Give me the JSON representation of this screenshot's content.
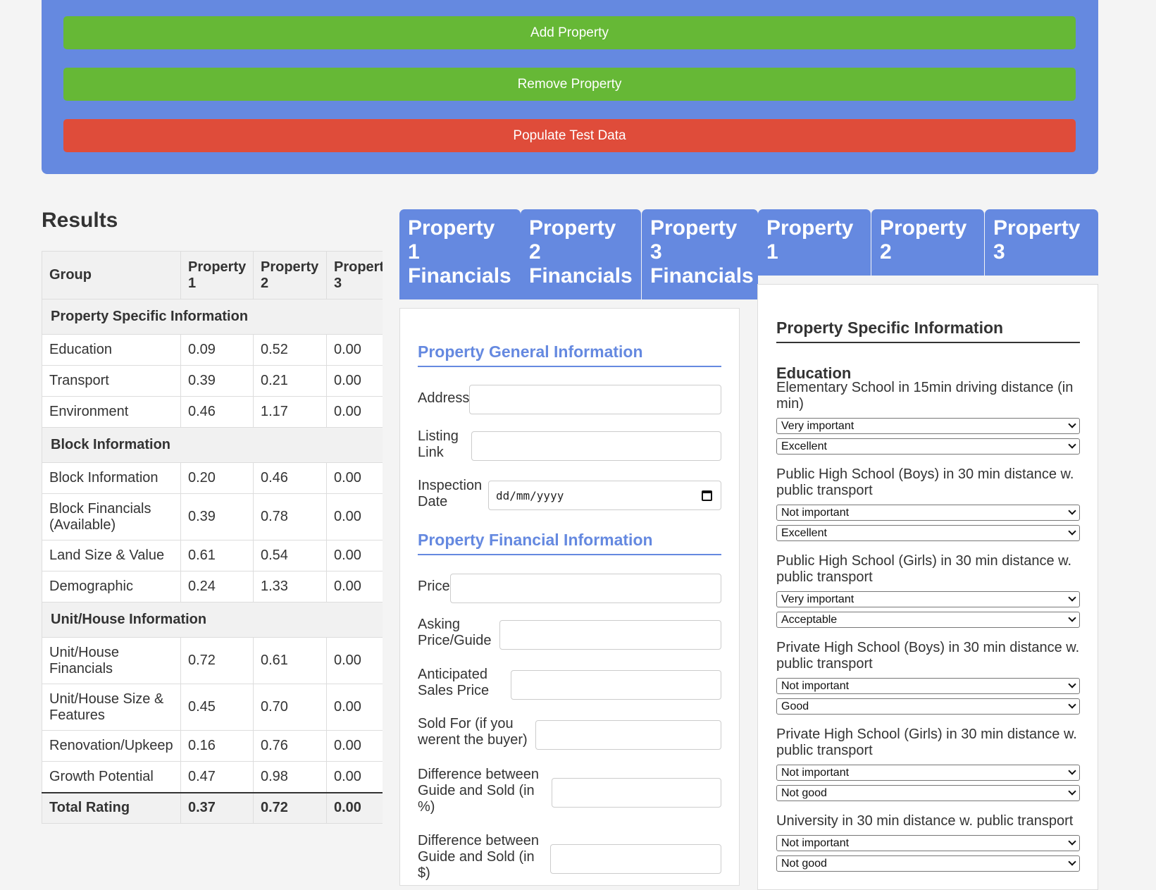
{
  "actions": {
    "add_label": "Add Property",
    "remove_label": "Remove Property",
    "populate_label": "Populate Test Data"
  },
  "colors": {
    "panel": "#6589e0",
    "green": "#66b836",
    "red": "#df4c3a"
  },
  "results": {
    "title": "Results",
    "headers": [
      "Group",
      "Property 1",
      "Property 2",
      "Propert 3"
    ],
    "sections": [
      {
        "title": "Property Specific Information",
        "rows": [
          {
            "label": "Education",
            "p1": "0.09",
            "p2": "0.52",
            "p3": "0.00"
          },
          {
            "label": "Transport",
            "p1": "0.39",
            "p2": "0.21",
            "p3": "0.00"
          },
          {
            "label": "Environment",
            "p1": "0.46",
            "p2": "1.17",
            "p3": "0.00"
          }
        ]
      },
      {
        "title": "Block Information",
        "rows": [
          {
            "label": "Block Information",
            "p1": "0.20",
            "p2": "0.46",
            "p3": "0.00"
          },
          {
            "label": "Block Financials (Available)",
            "p1": "0.39",
            "p2": "0.78",
            "p3": "0.00"
          },
          {
            "label": "Land Size & Value",
            "p1": "0.61",
            "p2": "0.54",
            "p3": "0.00"
          },
          {
            "label": "Demographic",
            "p1": "0.24",
            "p2": "1.33",
            "p3": "0.00"
          }
        ]
      },
      {
        "title": "Unit/House Information",
        "rows": [
          {
            "label": "Unit/House Financials",
            "p1": "0.72",
            "p2": "0.61",
            "p3": "0.00"
          },
          {
            "label": "Unit/House Size & Features",
            "p1": "0.45",
            "p2": "0.70",
            "p3": "0.00"
          },
          {
            "label": "Renovation/Upkeep",
            "p1": "0.16",
            "p2": "0.76",
            "p3": "0.00"
          },
          {
            "label": "Growth Potential",
            "p1": "0.47",
            "p2": "0.98",
            "p3": "0.00"
          }
        ]
      }
    ],
    "total": {
      "label": "Total Rating",
      "p1": "0.37",
      "p2": "0.72",
      "p3": "0.00"
    }
  },
  "tabs": {
    "fin1": [
      "Property",
      "1",
      "Financials"
    ],
    "fin2": [
      "Property",
      "2",
      "Financials"
    ],
    "fin3": [
      "Property",
      "3",
      "Financials"
    ],
    "prop1": [
      "Property",
      "1"
    ],
    "prop2": [
      "Property",
      "2"
    ],
    "prop3": [
      "Property",
      "3"
    ]
  },
  "financials": {
    "general_heading": "Property General Information",
    "financial_heading": "Property Financial Information",
    "address_label": "Address",
    "listing_link_label": [
      "Listing",
      "Link"
    ],
    "inspection_date_label": [
      "Inspection",
      "Date"
    ],
    "inspection_date_placeholder": "dd/mm/yyyy",
    "price_label": "Price",
    "asking_price_label": [
      "Asking",
      "Price/Guide"
    ],
    "anticipated_label": [
      "Anticipated",
      "Sales Price"
    ],
    "sold_for_label": [
      "Sold For (if you",
      "werent the buyer)"
    ],
    "diff_pct_label": [
      "Difference between",
      "Guide and Sold (in",
      "%)"
    ],
    "diff_dollar_label": [
      "Difference between",
      "Guide and Sold (in",
      "$)"
    ]
  },
  "specific": {
    "heading": "Property Specific Information",
    "subheading": "Education",
    "criteria": [
      {
        "label": "Elementary School in 15min driving distance (in min)",
        "importance": "Very important",
        "rating": "Excellent"
      },
      {
        "label": "Public High School (Boys) in 30 min distance w. public transport",
        "importance": "Not important",
        "rating": "Excellent"
      },
      {
        "label": "Public High School (Girls) in 30 min distance w. public transport",
        "importance": "Very important",
        "rating": "Acceptable"
      },
      {
        "label": "Private High School (Boys) in 30 min distance w. public transport",
        "importance": "Not important",
        "rating": "Good"
      },
      {
        "label": "Private High School (Girls) in 30 min distance w. public transport",
        "importance": "Not important",
        "rating": "Not good"
      },
      {
        "label": "University in 30 min distance w. public transport",
        "importance": "Not important",
        "rating": "Not good"
      }
    ]
  }
}
